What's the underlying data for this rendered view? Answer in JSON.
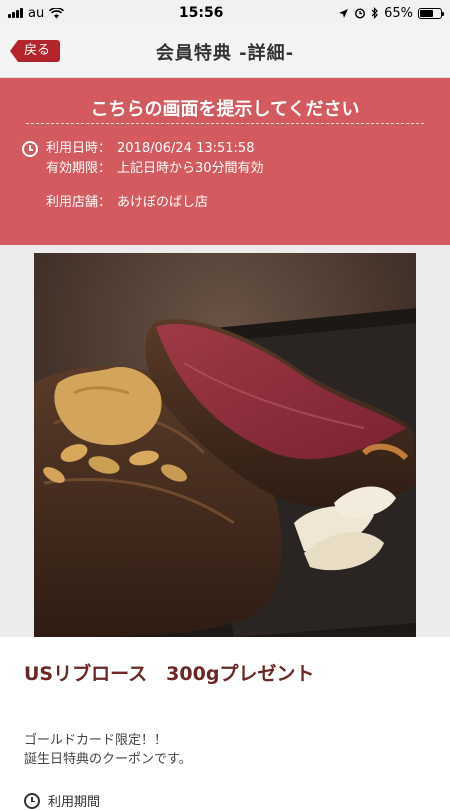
{
  "status_bar": {
    "carrier": "au",
    "time": "15:56",
    "battery": "65%",
    "battery_level": 0.65
  },
  "nav": {
    "back_label": "戻る",
    "title": "会員特典 -詳細-"
  },
  "banner": {
    "title": "こちらの画面を提示してください",
    "used_at_label": "利用日時：",
    "used_at_value": "2018/06/24 13:51:58",
    "expiry_label": "有効期限：",
    "expiry_value": "上記日時から30分間有効",
    "store_label": "利用店舗：",
    "store_value": "あけぼのばし店"
  },
  "coupon": {
    "headline": "USリブロース　300gプレゼント",
    "desc_line1": "ゴールドカード限定！！",
    "desc_line2": "誕生日特典のクーポンです。",
    "period_label": "利用期間"
  },
  "icons": {
    "clock": "clock-icon",
    "back": "back-arrow-icon"
  },
  "colors": {
    "accent": "#b3252b",
    "banner": "#d35a5f",
    "headline": "#6b2626"
  }
}
